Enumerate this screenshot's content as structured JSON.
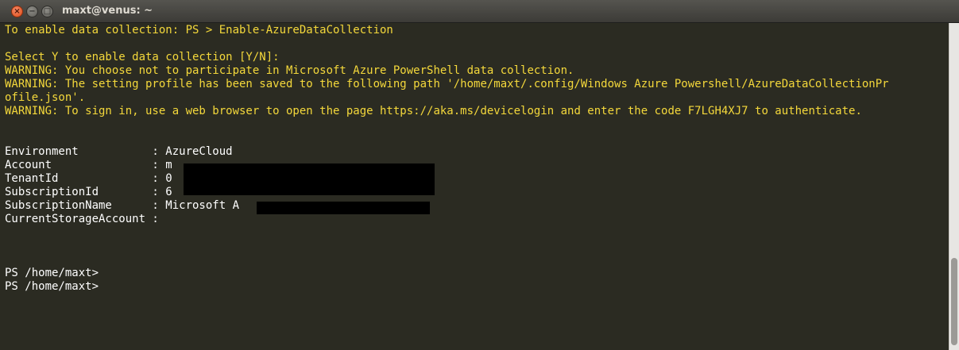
{
  "window": {
    "title": "maxt@venus: ~",
    "controls": {
      "close": "×",
      "minimize": "−",
      "maximize": "□"
    }
  },
  "terminal": {
    "lines": [
      {
        "text": "To enable data collection: PS > Enable-AzureDataCollection",
        "color": "yellow"
      },
      {
        "text": "",
        "color": "white"
      },
      {
        "text": "Select Y to enable data collection [Y/N]:",
        "color": "yellow"
      },
      {
        "text": "WARNING: You choose not to participate in Microsoft Azure PowerShell data collection.",
        "color": "yellow"
      },
      {
        "text": "WARNING: The setting profile has been saved to the following path '/home/maxt/.config/Windows Azure Powershell/AzureDataCollectionPr",
        "color": "yellow"
      },
      {
        "text": "ofile.json'.",
        "color": "yellow"
      },
      {
        "text": "WARNING: To sign in, use a web browser to open the page https://aka.ms/devicelogin and enter the code F7LGH4XJ7 to authenticate.",
        "color": "yellow"
      },
      {
        "text": "",
        "color": "white"
      },
      {
        "text": "",
        "color": "white"
      },
      {
        "text": "Environment           : AzureCloud",
        "color": "white"
      },
      {
        "text": "Account               : m",
        "color": "white"
      },
      {
        "text": "TenantId              : 0",
        "color": "white"
      },
      {
        "text": "SubscriptionId        : 6",
        "color": "white"
      },
      {
        "text": "SubscriptionName      : Microsoft A",
        "color": "white"
      },
      {
        "text": "CurrentStorageAccount :",
        "color": "white"
      },
      {
        "text": "",
        "color": "white"
      },
      {
        "text": "",
        "color": "white"
      },
      {
        "text": "",
        "color": "white"
      },
      {
        "text": "PS /home/maxt>",
        "color": "white"
      },
      {
        "text": "PS /home/maxt>",
        "color": "white"
      }
    ]
  },
  "colors": {
    "terminal_bg": "#2b2b22",
    "warning_text": "#f4d83b",
    "normal_text": "#ffffff",
    "close_button": "#df4b16"
  }
}
